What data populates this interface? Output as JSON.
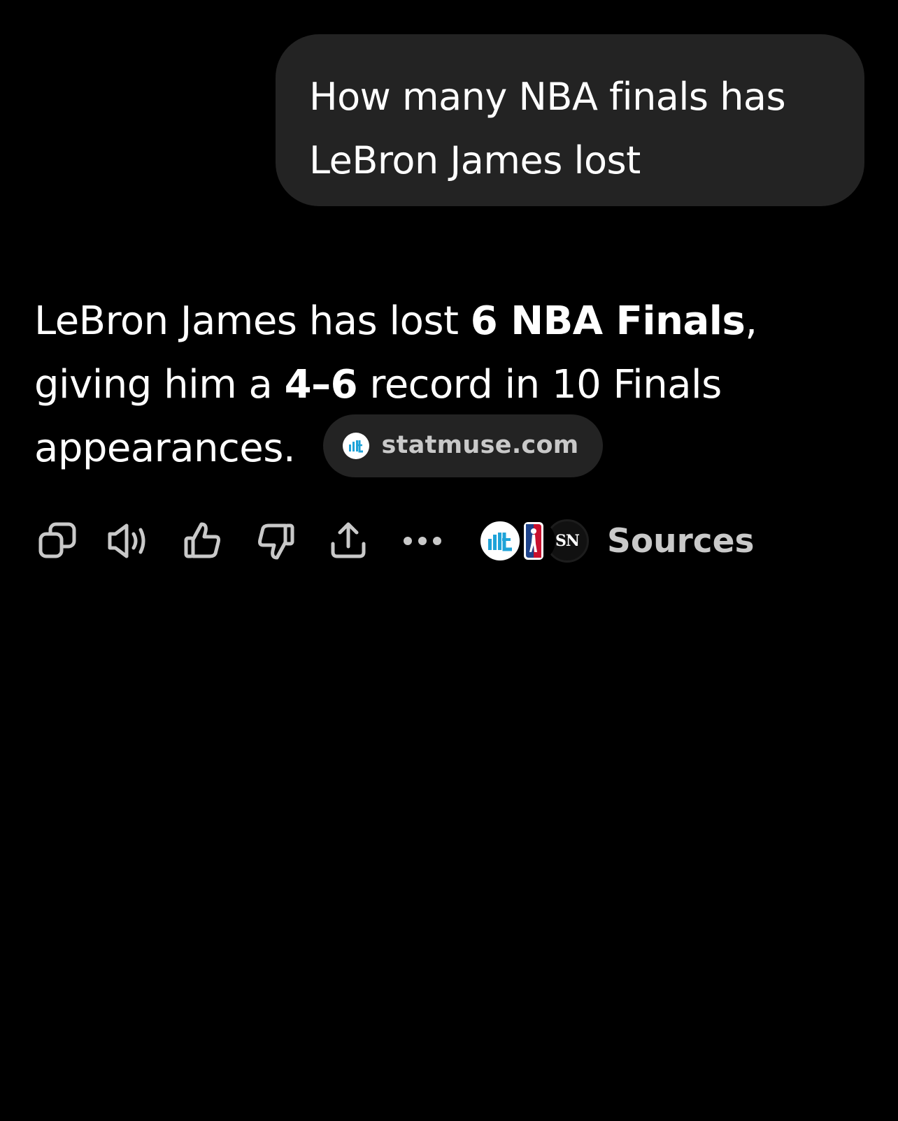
{
  "user_message": {
    "line1": "How many NBA finals has",
    "line2": "LeBron James lost"
  },
  "answer": {
    "part1": "LeBron James has lost ",
    "bold1": "6 NBA Finals",
    "part2": ", giving him a ",
    "bold2": "4–6",
    "part3": " record in 10 Finals appearances.",
    "source_chip": "statmuse.com"
  },
  "actions": {
    "icons": [
      "copy-icon",
      "speaker-icon",
      "thumbs-up-icon",
      "thumbs-down-icon",
      "share-icon",
      "more-icon"
    ],
    "sources_label": "Sources",
    "source_avatars": [
      "statmuse",
      "nba",
      "sn"
    ],
    "sn_label": "SN"
  },
  "colors": {
    "background": "#000000",
    "bubble": "#232323",
    "text": "#ffffff",
    "muted": "#c9c9c9",
    "statmuse_blue": "#1fa3d8"
  }
}
